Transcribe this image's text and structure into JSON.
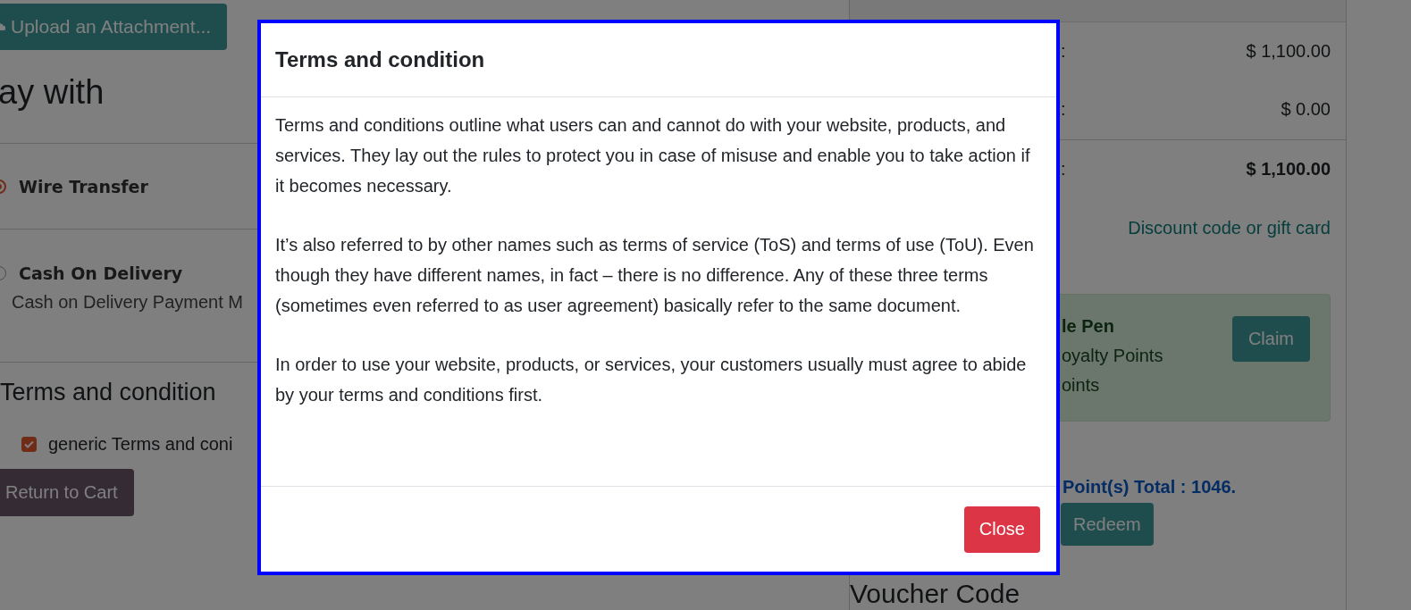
{
  "background": {
    "upload_button": "Upload an Attachment...",
    "heading": "ay with",
    "payment_methods": [
      {
        "name": "Wire Transfer",
        "selected": true
      },
      {
        "name": "Cash On Delivery",
        "description": "Cash on Delivery Payment M",
        "selected": false
      }
    ],
    "terms_heading": "Terms and condition",
    "terms_checkbox": {
      "label": "generic Terms and coni",
      "checked": true
    },
    "return_button": "Return to Cart",
    "summary_rows": [
      {
        "label": ":",
        "amount": "$ 1,100.00",
        "bold": false
      },
      {
        "label": ":",
        "amount": "$ 0.00",
        "bold": false
      },
      {
        "label": ":",
        "amount": "$ 1,100.00",
        "bold": true
      }
    ],
    "discount_link": "Discount code or gift card",
    "reward": {
      "title": "le Pen",
      "lines": [
        "oyalty Points",
        "oints"
      ],
      "button": "Claim"
    },
    "points_total": "Point(s) Total : 1046.",
    "redeem_button": "Redeem",
    "voucher_heading": "Voucher Code"
  },
  "modal": {
    "title": "Terms and condition",
    "paragraphs": [
      "Terms and conditions outline what users can and cannot do with your website, products, and services. They lay out the rules to protect you in case of misuse and enable you to take action if it becomes necessary.",
      "It’s also referred to by other names such as terms of service (ToS) and terms of use (ToU). Even though they have different names, in fact – there is no difference. Any of these three terms (sometimes even referred to as user agreement) basically refer to the same document.",
      "In order to use your website, products, or services, your customers usually must agree to abide by your terms and conditions first."
    ],
    "close_button": "Close"
  }
}
